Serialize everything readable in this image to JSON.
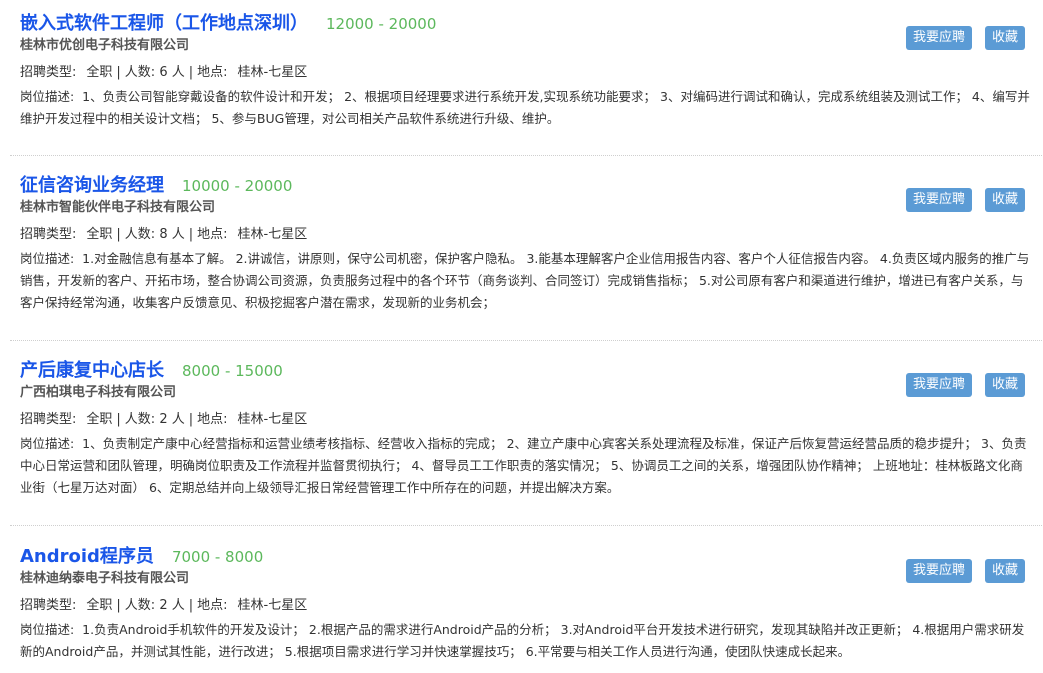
{
  "accent_color": "#1a56e8",
  "salary_color": "#5cb85c",
  "button_color": "#5b9bd5",
  "apply_label": "我要应聘",
  "favorite_label": "收藏",
  "meta_labels": {
    "type_label": "招聘类型:",
    "count_label": "人数:",
    "location_label": "地点:",
    "desc_label": "岗位描述:"
  },
  "jobs": [
    {
      "title": "嵌入式软件工程师（工作地点深圳）",
      "salary": "12000 - 20000",
      "company": "桂林市优创电子科技有限公司",
      "type": "全职",
      "count": "6 人",
      "location": "桂林-七星区",
      "description": "1、负责公司智能穿戴设备的软件设计和开发； 2、根据项目经理要求进行系统开发,实现系统功能要求； 3、对编码进行调试和确认，完成系统组装及测试工作； 4、编写并维护开发过程中的相关设计文档； 5、参与BUG管理，对公司相关产品软件系统进行升级、维护。"
    },
    {
      "title": "征信咨询业务经理",
      "salary": "10000 - 20000",
      "company": "桂林市智能伙伴电子科技有限公司",
      "type": "全职",
      "count": "8 人",
      "location": "桂林-七星区",
      "description": "1.对金融信息有基本了解。 2.讲诚信，讲原则，保守公司机密，保护客户隐私。 3.能基本理解客户企业信用报告内容、客户个人征信报告内容。 4.负责区域内服务的推广与销售，开发新的客户、开拓市场，整合协调公司资源，负责服务过程中的各个环节（商务谈判、合同签订）完成销售指标； 5.对公司原有客户和渠道进行维护，增进已有客户关系，与客户保持经常沟通，收集客户反馈意见、积极挖掘客户潜在需求，发现新的业务机会；"
    },
    {
      "title": "产后康复中心店长",
      "salary": "8000 - 15000",
      "company": "广西柏琪电子科技有限公司",
      "type": "全职",
      "count": "2 人",
      "location": "桂林-七星区",
      "description": "1、负责制定产康中心经营指标和运营业绩考核指标、经营收入指标的完成； 2、建立产康中心宾客关系处理流程及标准，保证产后恢复营运经营品质的稳步提升； 3、负责中心日常运营和团队管理，明确岗位职责及工作流程并监督贯彻执行； 4、督导员工工作职责的落实情况； 5、协调员工之间的关系，增强团队协作精神； 上班地址：桂林板路文化商业街（七星万达对面） 6、定期总结并向上级领导汇报日常经营管理工作中所存在的问题，并提出解决方案。"
    },
    {
      "title": "Android程序员",
      "salary": "7000 - 8000",
      "company": "桂林迪纳泰电子科技有限公司",
      "type": "全职",
      "count": "2 人",
      "location": "桂林-七星区",
      "description": "1.负责Android手机软件的开发及设计； 2.根据产品的需求进行Android产品的分析； 3.对Android平台开发技术进行研究，发现其缺陷并改正更新； 4.根据用户需求研发新的Android产品，并测试其性能，进行改进； 5.根据项目需求进行学习并快速掌握技巧； 6.平常要与相关工作人员进行沟通，使团队快速成长起来。"
    }
  ]
}
